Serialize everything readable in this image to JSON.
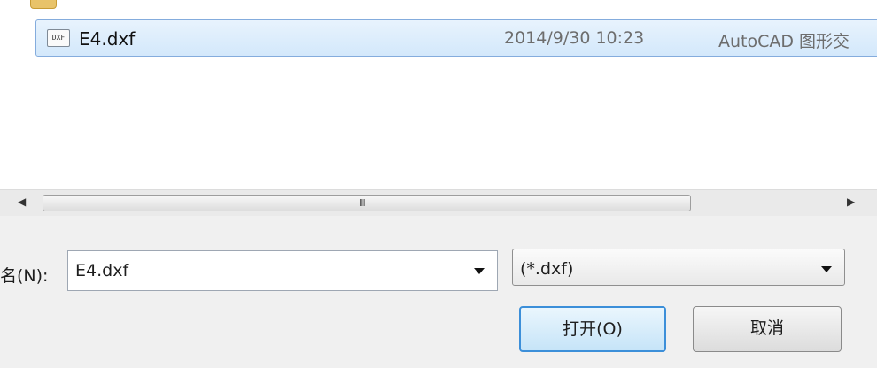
{
  "file_list": {
    "selected_file": {
      "name": "E4.dxf",
      "icon": "dxf-file-icon",
      "icon_text": "DXF",
      "modified": "2014/9/30 10:23",
      "type": "AutoCAD 图形交"
    }
  },
  "filename_field": {
    "label": "名(N):",
    "value": "E4.dxf"
  },
  "filetype_field": {
    "value": "(*.dxf)"
  },
  "buttons": {
    "open_label": "打开(O)",
    "cancel_label": "取消"
  },
  "scrollbar": {
    "grip": "III"
  }
}
